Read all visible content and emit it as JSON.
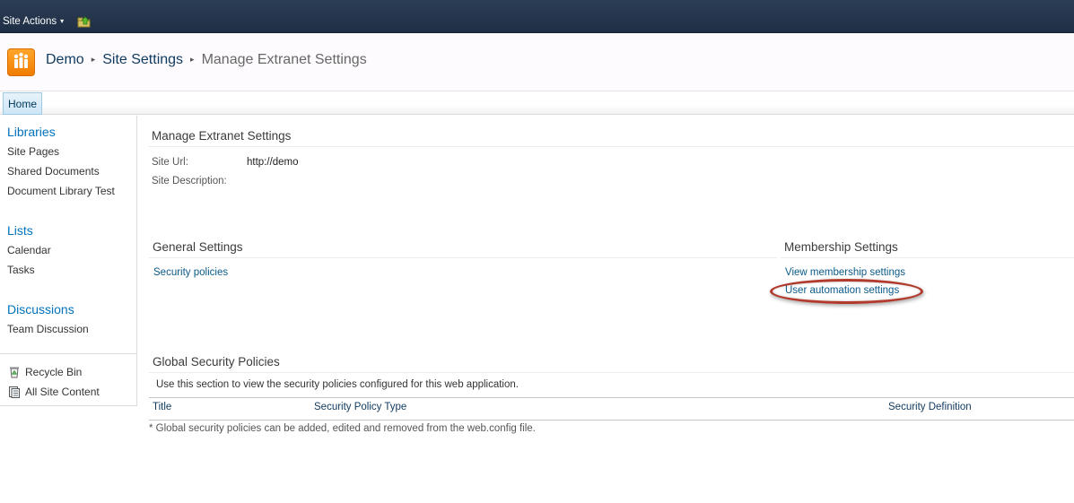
{
  "topbar": {
    "site_actions_label": "Site Actions",
    "caret_glyph": "▾",
    "navigate_up_icon": "folder-up-arrow-icon"
  },
  "title_area": {
    "logo_icon": "site-people-logo-icon",
    "breadcrumb": {
      "site": "Demo",
      "settings": "Site Settings",
      "current": "Manage Extranet Settings",
      "separator": "▸"
    }
  },
  "tabs": {
    "home": "Home"
  },
  "leftnav": {
    "libraries": {
      "heading": "Libraries",
      "items": [
        "Site Pages",
        "Shared Documents",
        "Document Library Test"
      ]
    },
    "lists": {
      "heading": "Lists",
      "items": [
        "Calendar",
        "Tasks"
      ]
    },
    "discussions": {
      "heading": "Discussions",
      "items": [
        "Team Discussion"
      ]
    },
    "recycle_bin": {
      "label": "Recycle Bin",
      "icon": "recycle-bin-icon"
    },
    "all_site_content": {
      "label": "All Site Content",
      "icon": "site-content-icon"
    }
  },
  "main": {
    "heading": "Manage Extranet Settings",
    "site_url_label": "Site Url:",
    "site_url_value": "http://demo",
    "site_description_label": "Site Description:",
    "general_settings": {
      "title": "General Settings",
      "links": [
        "Security policies"
      ]
    },
    "membership_settings": {
      "title": "Membership Settings",
      "links": [
        "View membership settings",
        "User automation settings"
      ]
    },
    "global_security_policies": {
      "title": "Global Security Policies",
      "description": "Use this section to view the security policies configured for this web application.",
      "columns": [
        "Title",
        "Security Policy Type",
        "Security Definition"
      ],
      "footnote": "* Global security policies can be added, edited and removed from the web.config file."
    }
  },
  "colors": {
    "topbar": "#2b3d55",
    "link": "#0a5a8a",
    "nav_heading": "#0072bc",
    "highlight": "#b23a2c",
    "logo": "#f7931e"
  }
}
